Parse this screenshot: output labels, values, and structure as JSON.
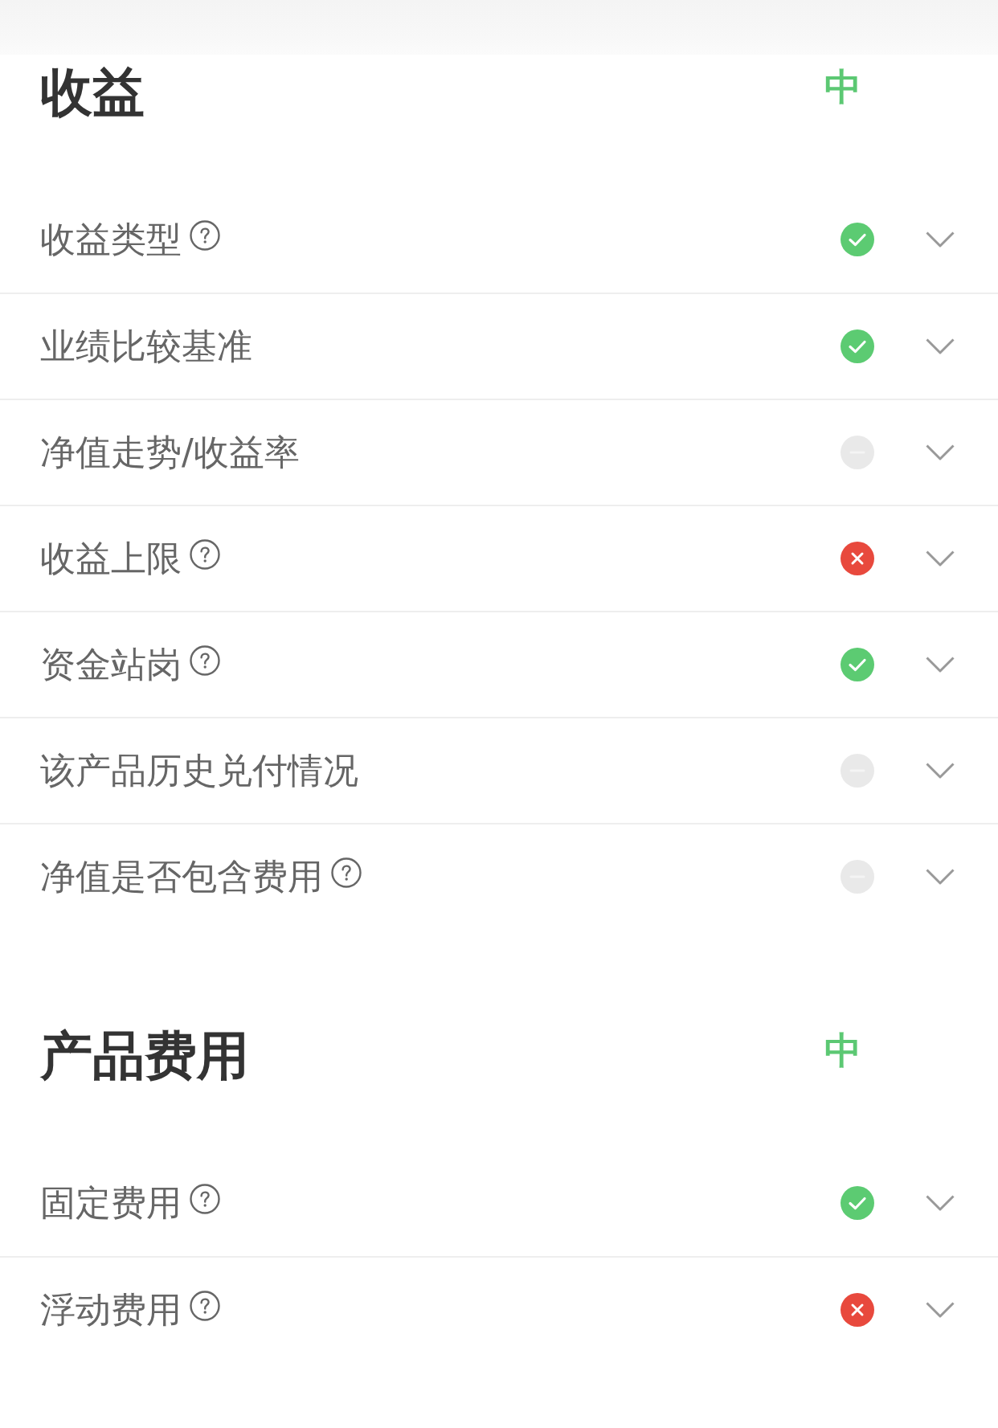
{
  "sections": [
    {
      "title": "收益",
      "rating": "中",
      "items": [
        {
          "label": "收益类型",
          "help": true,
          "kind": "pass"
        },
        {
          "label": "业绩比较基准",
          "help": false,
          "kind": "pass"
        },
        {
          "label": "净值走势/收益率",
          "help": false,
          "kind": "none"
        },
        {
          "label": "收益上限",
          "help": true,
          "kind": "fail"
        },
        {
          "label": "资金站岗",
          "help": true,
          "kind": "pass"
        },
        {
          "label": "该产品历史兑付情况",
          "help": false,
          "kind": "none"
        },
        {
          "label": "净值是否包含费用",
          "help": true,
          "kind": "none"
        }
      ]
    },
    {
      "title": "产品费用",
      "rating": "中",
      "items": [
        {
          "label": "固定费用",
          "help": true,
          "kind": "pass"
        },
        {
          "label": "浮动费用",
          "help": true,
          "kind": "fail"
        }
      ]
    }
  ]
}
